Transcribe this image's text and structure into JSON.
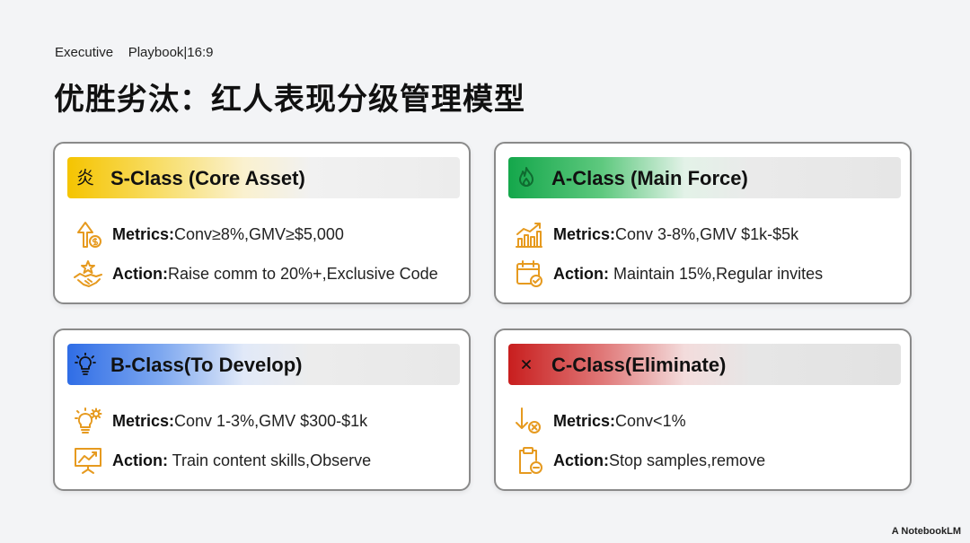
{
  "header": {
    "topline": "Executive    Playbook|16:9",
    "title": "优胜劣汰：红人表现分级管理模型"
  },
  "cards": [
    {
      "key": "s",
      "accent": "#f5c400",
      "head_icon": "fire-icon",
      "title": "S-Class (Core Asset)",
      "metrics_label": "Metrics:",
      "metrics_value": "Conv≥8%,GMV≥$5,000",
      "metrics_icon": "arrow-up-dollar-icon",
      "action_label": "Action:",
      "action_value": "Raise comm to 20%+,Exclusive Code",
      "action_icon": "handshake-star-icon"
    },
    {
      "key": "a",
      "accent": "#14a74b",
      "head_icon": "flame-icon",
      "title": "A-Class (Main Force)",
      "metrics_label": "Metrics:",
      "metrics_value": "Conv 3-8%,GMV $1k-$5k",
      "metrics_icon": "bar-chart-up-icon",
      "action_label": "Action:",
      "action_value": " Maintain 15%,Regular invites",
      "action_icon": "calendar-check-icon"
    },
    {
      "key": "b",
      "accent": "#2f6de6",
      "head_icon": "lightbulb-icon",
      "title": "B-Class(To Develop)",
      "metrics_label": "Metrics:",
      "metrics_value": "Conv 1-3%,GMV $300-$1k",
      "metrics_icon": "lightbulb-gear-icon",
      "action_label": "Action:",
      "action_value": " Train content skills,Observe",
      "action_icon": "presentation-board-icon"
    },
    {
      "key": "c",
      "accent": "#c81e1e",
      "head_icon": "x-icon",
      "title": "C-Class(Eliminate)",
      "metrics_label": "Metrics:",
      "metrics_value": "Conv<1%",
      "metrics_icon": "arrow-down-x-icon",
      "action_label": "Action:",
      "action_value": "Stop samples,remove",
      "action_icon": "clipboard-minus-icon"
    }
  ],
  "footer": {
    "watermark": "A NotebookLM"
  }
}
